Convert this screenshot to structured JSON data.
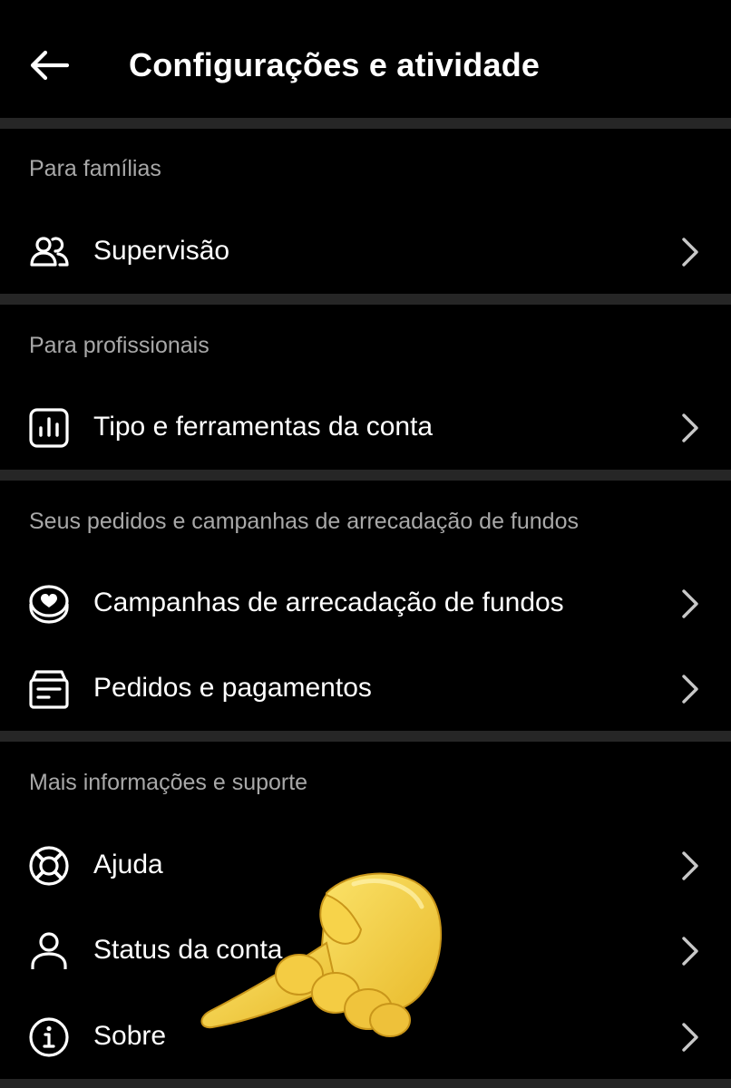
{
  "header": {
    "title": "Configurações e atividade",
    "back_icon": "arrow-left-icon"
  },
  "sections": [
    {
      "header": "Para famílias",
      "items": [
        {
          "label": "Supervisão",
          "icon": "people-icon"
        }
      ]
    },
    {
      "header": "Para profissionais",
      "items": [
        {
          "label": "Tipo e ferramentas da conta",
          "icon": "bar-chart-icon"
        }
      ]
    },
    {
      "header": "Seus pedidos e campanhas de arrecadação de fundos",
      "items": [
        {
          "label": "Campanhas de arrecadação de fundos",
          "icon": "heart-coin-icon"
        },
        {
          "label": "Pedidos e pagamentos",
          "icon": "receipt-icon"
        }
      ]
    },
    {
      "header": "Mais informações e suporte",
      "items": [
        {
          "label": "Ajuda",
          "icon": "lifebuoy-icon"
        },
        {
          "label": "Status da conta",
          "icon": "person-icon"
        },
        {
          "label": "Sobre",
          "icon": "info-icon"
        }
      ]
    }
  ],
  "colors": {
    "background": "#000000",
    "text_primary": "#ffffff",
    "text_secondary": "#a8a8a8",
    "divider": "#262626",
    "overlay_hand": "#f5d33f"
  },
  "overlay": {
    "icon": "pointing-hand-emoji"
  }
}
